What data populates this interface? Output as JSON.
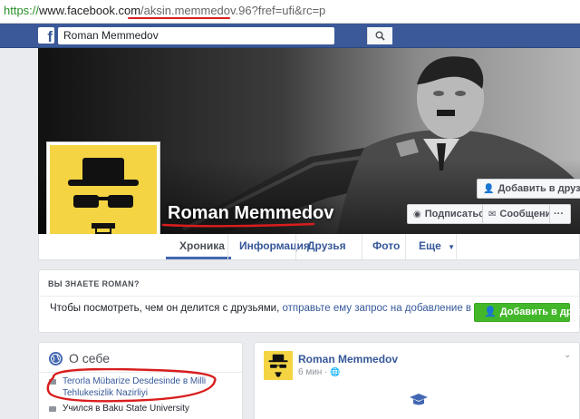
{
  "browser": {
    "url_scheme": "https://",
    "url_domain": "www.facebook.com",
    "url_path": "/aksin.memmedov.96",
    "url_query": "?fref=ufi&rc=p"
  },
  "topbar": {
    "logo": "f",
    "search_value": "Roman Memmedov"
  },
  "profile": {
    "name": "Roman Memmedov",
    "add_friend": "Добавить в друзья",
    "follow": "Подписаться",
    "message": "Сообщение",
    "more": "···"
  },
  "tabs": [
    {
      "label": "Хроника",
      "active": true
    },
    {
      "label": "Информация",
      "active": false
    },
    {
      "label": "Друзья",
      "active": false
    },
    {
      "label": "Фото",
      "active": false
    },
    {
      "label": "Еще",
      "active": false
    }
  ],
  "know_box": {
    "heading": "ВЫ ЗНАЕТЕ ROMAN?",
    "text_before": "Чтобы посмотреть, чем он делится с друзьями, ",
    "text_link": "отправьте ему запрос на добавление в друзья.",
    "button": "Добавить в друзья"
  },
  "about": {
    "title": "О себе",
    "work_line1": "Terorla Mübarize Desdesinde в Milli",
    "work_line2": "Tehlukesizlik Nazirliyi",
    "study": "Учился в Baku State University"
  },
  "post": {
    "author": "Roman Memmedov",
    "time": "6 мин · ",
    "chevron": "⌄"
  },
  "colors": {
    "fb_blue": "#3b5998",
    "link": "#365899",
    "green": "#42b72a",
    "annotation_red": "#d91d1d",
    "avatar_yellow": "#f4d442"
  }
}
